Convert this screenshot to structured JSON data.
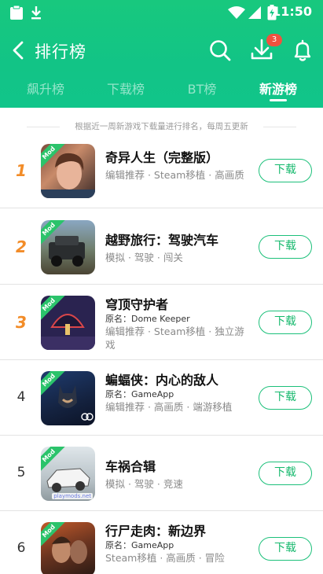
{
  "status_bar": {
    "time": "11:50",
    "icons": [
      "clipboard-icon",
      "download-notify-icon",
      "wifi-icon",
      "battery-charging-icon"
    ]
  },
  "header": {
    "title": "排行榜",
    "download_badge": "3",
    "icons": [
      "back-arrow-icon",
      "search-icon",
      "download-icon",
      "bell-icon"
    ]
  },
  "tabs": [
    {
      "label": "飙升榜",
      "active": false
    },
    {
      "label": "下载榜",
      "active": false
    },
    {
      "label": "BT榜",
      "active": false
    },
    {
      "label": "新游榜",
      "active": true
    }
  ],
  "notice": "根据近一周新游戏下载量进行排名，每周五更新",
  "download_label": "下载",
  "mod_label": "Mod",
  "games": [
    {
      "rank": "1",
      "name": "奇异人生（完整版）",
      "original": "",
      "tags": "编辑推荐 · Steam移植 · 高画质"
    },
    {
      "rank": "2",
      "name": "越野旅行：驾驶汽车",
      "original": "",
      "tags": "模拟 · 驾驶 · 闯关"
    },
    {
      "rank": "3",
      "name": "穹顶守护者",
      "original": "原名：Dome Keeper",
      "tags": "编辑推荐 · Steam移植 · 独立游戏"
    },
    {
      "rank": "4",
      "name": "蝙蝠侠：内心的敌人",
      "original": "原名：GameApp",
      "tags": "编辑推荐 · 高画质 · 端游移植"
    },
    {
      "rank": "5",
      "name": "车祸合辑",
      "original": "",
      "tags": "模拟 · 驾驶 · 竞速",
      "watermark": "playmods.net"
    },
    {
      "rank": "6",
      "name": "行尸走肉：新边界",
      "original": "原名：GameApp",
      "tags": "Steam移植 · 高画质 · 冒险"
    }
  ],
  "colors": {
    "header_green": "#15c684",
    "accent_green": "#1cc07a",
    "rank_orange": "#f28c28",
    "badge_red": "#f0513f",
    "mod_tag_green": "#2bc36b"
  }
}
